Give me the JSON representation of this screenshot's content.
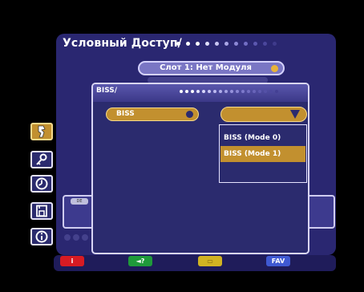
{
  "outer_window": {
    "title": "Условный Доступ/",
    "slot_label": "Слот 1: Нет Модуля"
  },
  "dialog": {
    "title": "BISS/",
    "option_label": "BISS",
    "mode_options": [
      "BISS (Mode 0)",
      "BISS (Mode 1)"
    ],
    "selected_mode_index": 1
  },
  "sidebar": {
    "icons": [
      "satellite-settings-icon",
      "key-icon",
      "clock-icon",
      "save-icon",
      "info-icon"
    ],
    "active_index": 0
  },
  "info_strip": {
    "chip_text": "DE"
  },
  "bottom_bar": {
    "red_label": "i",
    "green_label": "◄?",
    "yellow_label": "▭",
    "blue_label": "FAV"
  },
  "colors": {
    "panel": "#2b2b6e",
    "accent_gold": "#c2902f",
    "red": "#d81b23",
    "green": "#1f9a3a",
    "yellow": "#d1b322",
    "blue": "#3f59d2"
  }
}
